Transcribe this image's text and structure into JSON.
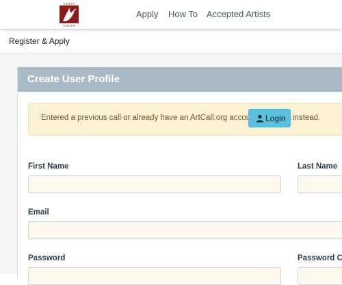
{
  "logo": {
    "text": "VALLEY CENTER",
    "colors": {
      "primary": "#8b1a1a"
    }
  },
  "nav": {
    "items": [
      {
        "label": "Apply"
      },
      {
        "label": "How To"
      },
      {
        "label": "Accepted Artists"
      }
    ]
  },
  "breadcrumb": {
    "label": "Register & Apply"
  },
  "panel": {
    "title": "Create User Profile"
  },
  "notice": {
    "text_before": "Entered a previous call or already have an ArtCall.org account?",
    "login_label": "Login",
    "login_icon": "user-icon",
    "text_after": "instead."
  },
  "form": {
    "first_name": {
      "label": "First Name",
      "value": ""
    },
    "last_name": {
      "label": "Last Name",
      "value": ""
    },
    "email": {
      "label": "Email",
      "value": ""
    },
    "password": {
      "label": "Password",
      "value": ""
    },
    "password_confirm": {
      "label": "Password Co",
      "value": ""
    }
  },
  "colors": {
    "panel_header": "#a9bcc6",
    "notice_bg": "#fbf1d5",
    "login_button": "#5bc0de",
    "input_bg": "#fdf9ee"
  }
}
